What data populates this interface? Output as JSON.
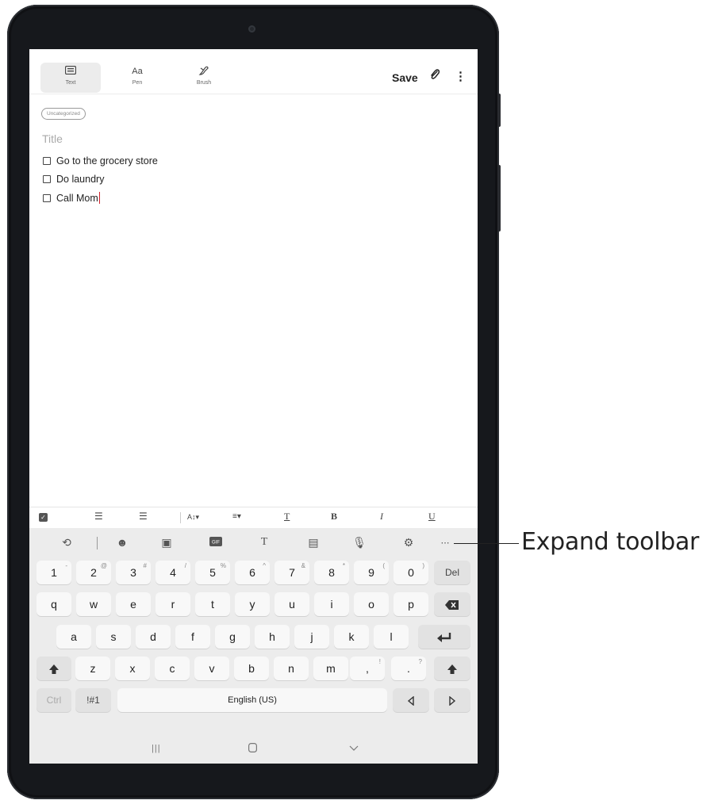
{
  "toolbar": {
    "modes": [
      {
        "label": "Text",
        "icon": "keyboard-icon"
      },
      {
        "label": "Pen",
        "icon": "Aa"
      },
      {
        "label": "Brush",
        "icon": "brush-icon"
      }
    ],
    "save_label": "Save"
  },
  "note": {
    "category": "Uncategorized",
    "title_placeholder": "Title",
    "items": [
      "Go to the grocery store",
      "Do laundry",
      "Call Mom"
    ]
  },
  "keyboard": {
    "number_row": [
      {
        "k": "1",
        "s": "-"
      },
      {
        "k": "2",
        "s": "@"
      },
      {
        "k": "3",
        "s": "#"
      },
      {
        "k": "4",
        "s": "/"
      },
      {
        "k": "5",
        "s": "%"
      },
      {
        "k": "6",
        "s": "^"
      },
      {
        "k": "7",
        "s": "&"
      },
      {
        "k": "8",
        "s": "*"
      },
      {
        "k": "9",
        "s": "("
      },
      {
        "k": "0",
        "s": ")"
      }
    ],
    "del_label": "Del",
    "row_q": [
      "q",
      "w",
      "e",
      "r",
      "t",
      "y",
      "u",
      "i",
      "o",
      "p"
    ],
    "row_a": [
      "a",
      "s",
      "d",
      "f",
      "g",
      "h",
      "j",
      "k",
      "l"
    ],
    "row_z": [
      "z",
      "x",
      "c",
      "v",
      "b",
      "n",
      "m"
    ],
    "comma": ",",
    "comma_sub": "!",
    "period": ".",
    "period_sub": "?",
    "ctrl_label": "Ctrl",
    "sym_label": "!#1",
    "space_label": "English (US)"
  },
  "annotation": {
    "label": "Expand toolbar"
  }
}
